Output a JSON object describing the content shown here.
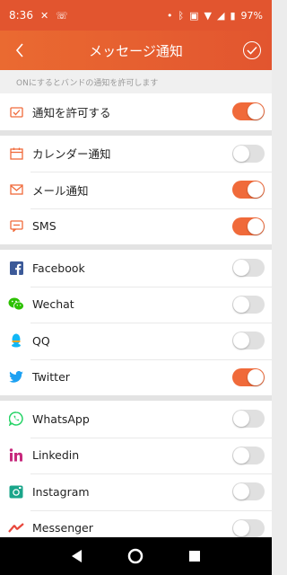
{
  "status": {
    "time": "8:36",
    "battery": "97%"
  },
  "app_bar": {
    "title": "メッセージ通知"
  },
  "subtitle": "ONにするとバンドの通知を許可します",
  "colors": {
    "accent": "#f06a3a",
    "header": "#e2552f"
  },
  "sections": [
    [
      {
        "label": "通知を許可する",
        "on": true,
        "icon": "notify-icon"
      }
    ],
    [
      {
        "label": "カレンダー通知",
        "on": false,
        "icon": "calendar-icon"
      },
      {
        "label": "メール通知",
        "on": true,
        "icon": "mail-icon"
      },
      {
        "label": "SMS",
        "on": true,
        "icon": "sms-icon"
      }
    ],
    [
      {
        "label": "Facebook",
        "on": false,
        "icon": "facebook-icon"
      },
      {
        "label": "Wechat",
        "on": false,
        "icon": "wechat-icon"
      },
      {
        "label": "QQ",
        "on": false,
        "icon": "qq-icon"
      },
      {
        "label": "Twitter",
        "on": true,
        "icon": "twitter-icon"
      }
    ],
    [
      {
        "label": "WhatsApp",
        "on": false,
        "icon": "whatsapp-icon"
      },
      {
        "label": "Linkedin",
        "on": false,
        "icon": "linkedin-icon"
      },
      {
        "label": "Instagram",
        "on": false,
        "icon": "instagram-icon"
      },
      {
        "label": "Messenger",
        "on": false,
        "icon": "messenger-icon"
      }
    ]
  ]
}
